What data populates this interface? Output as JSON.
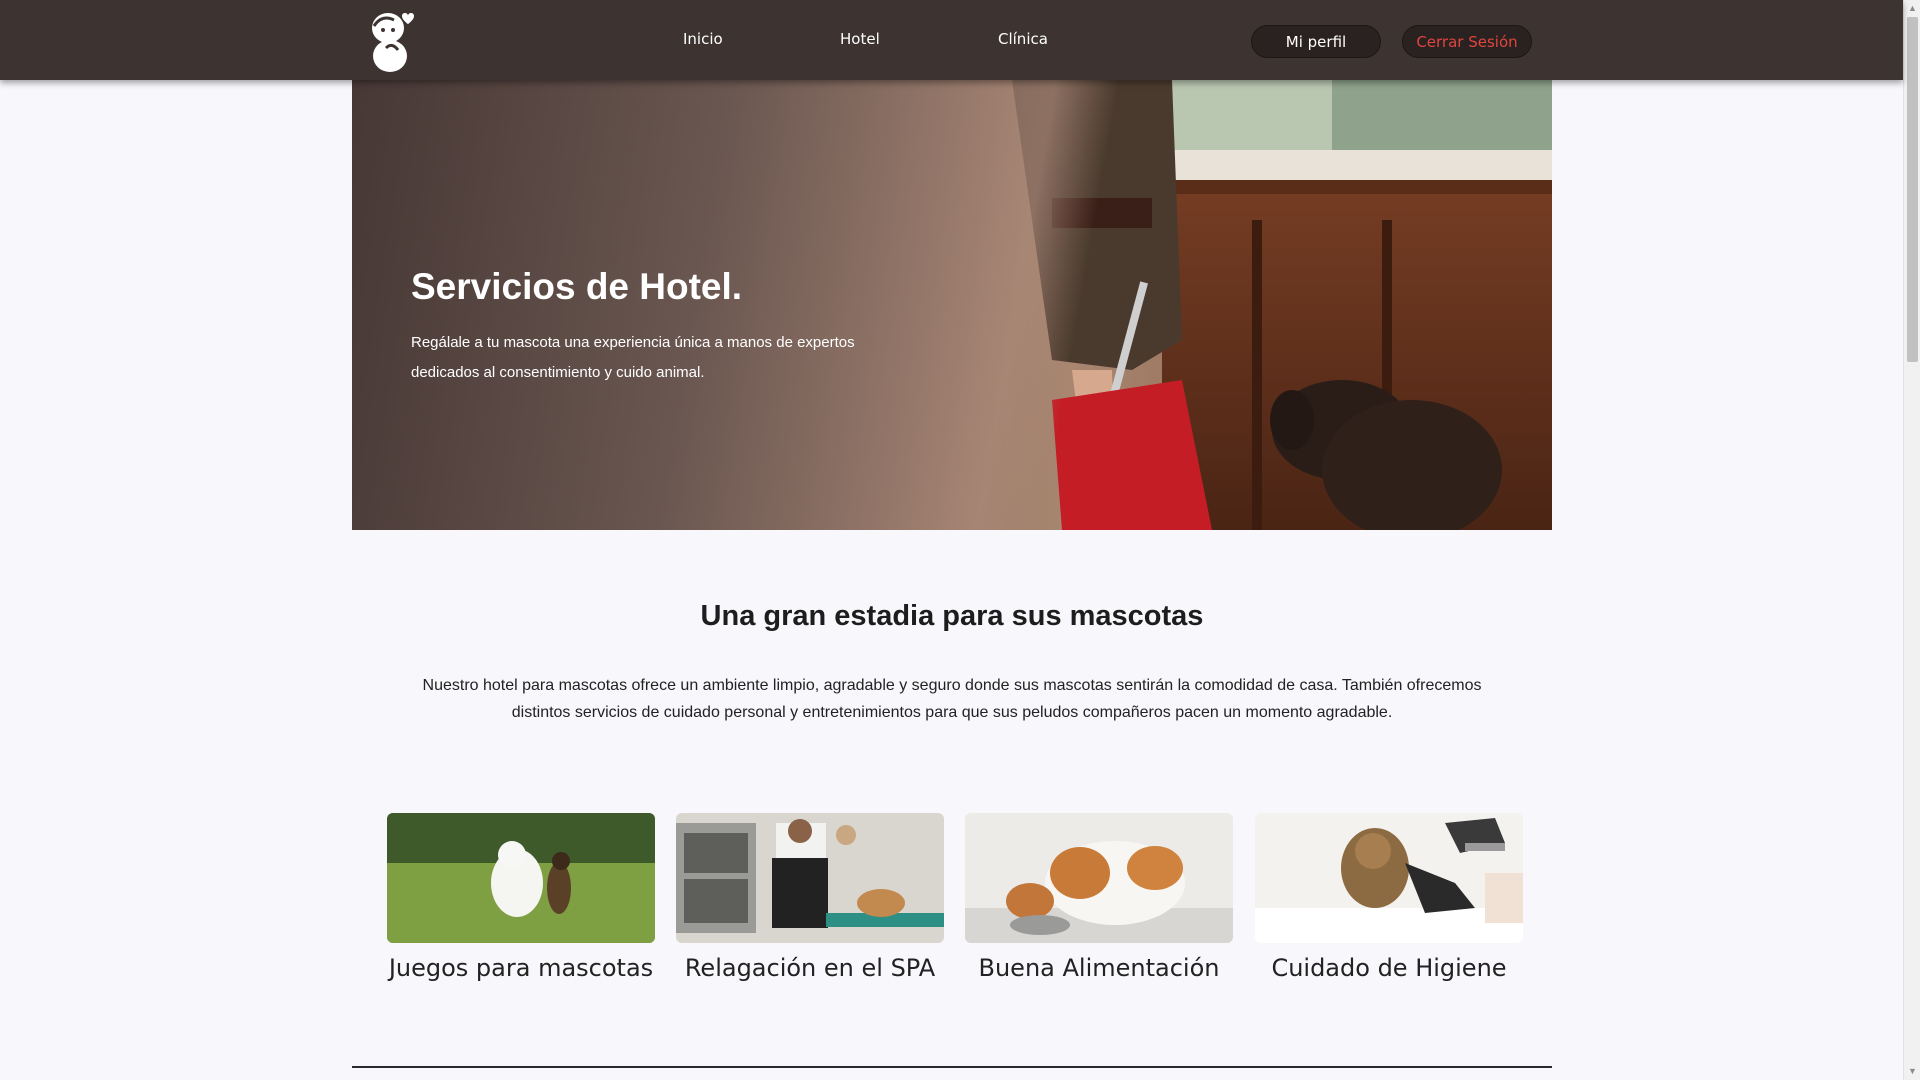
{
  "header": {
    "nav": [
      "Inicio",
      "Hotel",
      "Clínica"
    ],
    "profile_label": "Mi perfil",
    "logout_label": "Cerrar Sesión",
    "logo_icon": "pet-heart-logo-icon",
    "colors": {
      "bar": "#3d3431",
      "logout_text": "#e0453f"
    }
  },
  "hero": {
    "title": "Servicios de Hotel.",
    "text": "Regálale a tu mascota una experiencia única a manos de expertos dedicados al consentimiento y cuido animal."
  },
  "section": {
    "title": "Una gran estadia para sus mascotas",
    "text": "Nuestro hotel para mascotas ofrece un ambiente limpio, agradable y seguro donde sus mascotas sentirán la comodidad de casa. También ofrecemos distintos servicios de cuidado personal y entretenimientos para que sus peludos compañeros pacen un momento agradable."
  },
  "services": [
    {
      "label": "Juegos para mascotas"
    },
    {
      "label": "Relagación en el SPA"
    },
    {
      "label": "Buena Alimentación"
    },
    {
      "label": "Cuidado de Higiene"
    }
  ]
}
